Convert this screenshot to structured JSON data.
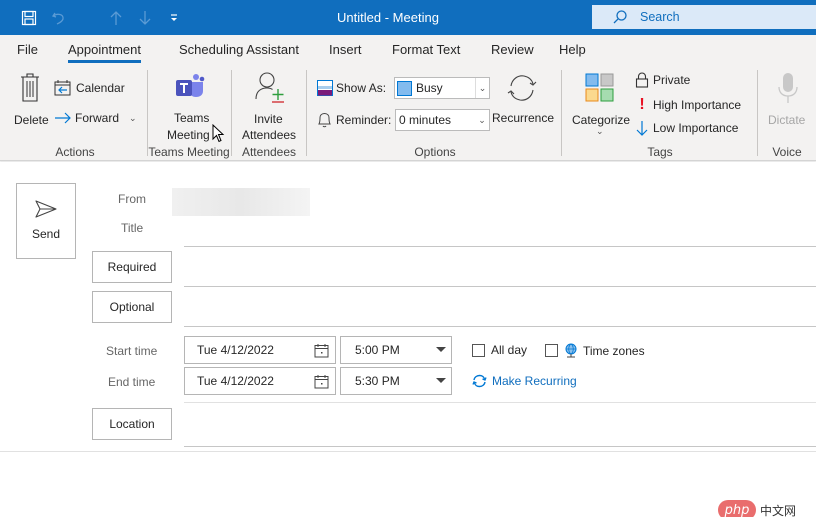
{
  "titlebar": {
    "title": "Untitled  -  Meeting",
    "search_placeholder": "Search",
    "quick_access": [
      "save-icon",
      "undo-icon",
      "up-arrow-icon",
      "down-arrow-icon",
      "customize-qat-icon"
    ]
  },
  "tabs": [
    {
      "label": "File",
      "active": false
    },
    {
      "label": "Appointment",
      "active": true
    },
    {
      "label": "Scheduling Assistant",
      "active": false
    },
    {
      "label": "Insert",
      "active": false
    },
    {
      "label": "Format Text",
      "active": false
    },
    {
      "label": "Review",
      "active": false
    },
    {
      "label": "Help",
      "active": false
    }
  ],
  "ribbon": {
    "actions": {
      "group_label": "Actions",
      "delete": "Delete",
      "calendar": "Calendar",
      "forward": "Forward"
    },
    "teams": {
      "group_label": "Teams Meeting",
      "button_line1": "Teams",
      "button_line2": "Meeting"
    },
    "attendees": {
      "group_label": "Attendees",
      "button_line1": "Invite",
      "button_line2": "Attendees"
    },
    "options": {
      "group_label": "Options",
      "show_as_label": "Show As:",
      "show_as_value": "Busy",
      "reminder_label": "Reminder:",
      "reminder_value": "0 minutes",
      "recurrence": "Recurrence"
    },
    "tags": {
      "group_label": "Tags",
      "categorize": "Categorize",
      "private": "Private",
      "high_importance": "High Importance",
      "low_importance": "Low Importance"
    },
    "voice": {
      "group_label": "Voice",
      "dictate": "Dictate"
    }
  },
  "form": {
    "send": "Send",
    "from_label": "From",
    "title_label": "Title",
    "title_value": "",
    "required": "Required",
    "required_value": "",
    "optional": "Optional",
    "optional_value": "",
    "start_time_label": "Start time",
    "start_date": "Tue 4/12/2022",
    "start_time": "5:00 PM",
    "end_time_label": "End time",
    "end_date": "Tue 4/12/2022",
    "end_time": "5:30 PM",
    "all_day": "All day",
    "all_day_checked": false,
    "time_zones": "Time zones",
    "time_zones_checked": false,
    "make_recurring": "Make Recurring",
    "location": "Location",
    "location_value": ""
  },
  "colors": {
    "accent": "#106ebe",
    "ribbon_bg": "#f3f2f1",
    "high_importance": "#e81123",
    "low_importance": "#0078d4"
  },
  "watermark": {
    "badge": "php",
    "text": "中文网"
  }
}
